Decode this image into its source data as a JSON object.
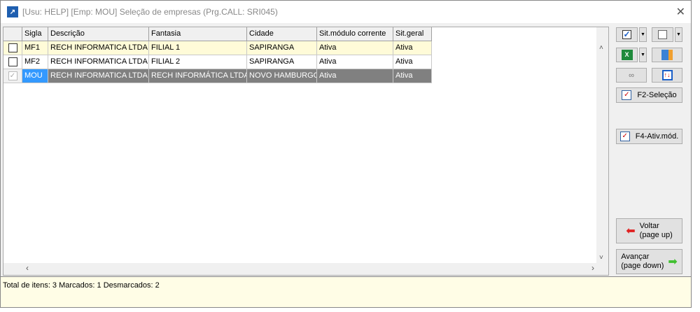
{
  "window": {
    "title": "[Usu: HELP] [Emp: MOU] Seleção de empresas (Prg.CALL: SRI045)"
  },
  "grid": {
    "columns": [
      "",
      "Sigla",
      "Descrição",
      "Fantasia",
      "Cidade",
      "Sit.módulo corrente",
      "Sit.geral"
    ],
    "rows": [
      {
        "checked": false,
        "sigla": "MF1",
        "descricao": "RECH INFORMATICA LTDA",
        "fantasia": "FILIAL 1",
        "cidade": "SAPIRANGA",
        "sit_modulo": "Ativa",
        "sit_geral": "Ativa"
      },
      {
        "checked": false,
        "sigla": "MF2",
        "descricao": "RECH INFORMATICA LTDA",
        "fantasia": "FILIAL 2",
        "cidade": "SAPIRANGA",
        "sit_modulo": "Ativa",
        "sit_geral": "Ativa"
      },
      {
        "checked": true,
        "sigla": "MOU",
        "descricao": "RECH INFORMATICA LTDA",
        "fantasia": "RECH INFORMÁTICA LTDA",
        "cidade": "NOVO HAMBURGO",
        "sit_modulo": "Ativa",
        "sit_geral": "Ativa"
      }
    ]
  },
  "side": {
    "f2": "F2-Seleção",
    "f4": "F4-Ativ.mód.",
    "voltar": "Voltar",
    "voltar_sub": "(page up)",
    "avancar": "Avançar",
    "avancar_sub": "(page down)"
  },
  "status": {
    "text": "Total de itens: 3 Marcados: 1 Desmarcados: 2"
  }
}
